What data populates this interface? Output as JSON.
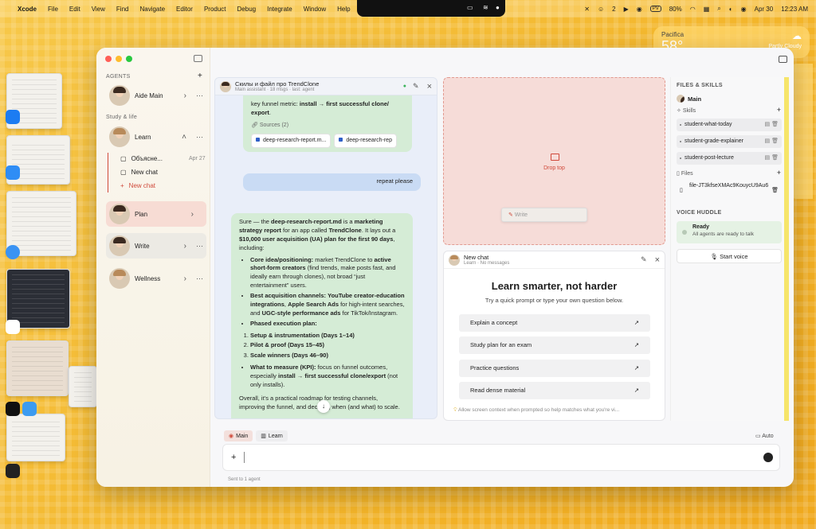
{
  "menubar": {
    "app": "Xcode",
    "items": [
      "File",
      "Edit",
      "View",
      "Find",
      "Navigate",
      "Editor",
      "Product",
      "Debug",
      "Integrate",
      "Window",
      "Help"
    ],
    "right": {
      "badge_count": "2",
      "pv": "PV",
      "battery": "80%",
      "date": "Apr 30",
      "time": "12:23 AM"
    }
  },
  "weather": {
    "city": "Pacifica",
    "temp": "58°",
    "cond": "Partly Cloudy"
  },
  "sidebar": {
    "agents_label": "AGENTS",
    "aide": "Aide Main",
    "study_label": "Study & life",
    "learn": "Learn",
    "sub_chat_1": "Объясне...",
    "sub_chat_1_date": "Apr 27",
    "sub_chat_2": "New chat",
    "sub_new": "New chat",
    "plan": "Plan",
    "write": "Write",
    "wellness": "Wellness"
  },
  "chat": {
    "title": "Скилы и файл про TrendClone",
    "subtitle": "Main assistant · 18 msgs · last: agent",
    "top_text_1": "key funnel metric: ",
    "top_text_bold": "install → first successful clone/ export",
    "sources_label": "Sources (2)",
    "source_1": "deep-research-report.m...",
    "source_2": "deep-research-rep",
    "user_msg": "repeat please",
    "reply_intro_1": "Sure — the ",
    "reply_file": "deep-research-report.md",
    "reply_intro_2": " is a ",
    "reply_bold_1": "marketing strategy report",
    "reply_intro_3": " for an app called ",
    "reply_app": "TrendClone",
    "reply_intro_4": ". It lays out a ",
    "reply_bold_2": "$10,000 user acquisition (UA) plan for the first 90 days",
    "reply_intro_5": ", including:",
    "b1_bold": "Core idea/positioning:",
    "b1_text_1": " market TrendClone to ",
    "b1_bold_2": "active short-form creators",
    "b1_text_2": " (find trends, make posts fast, and ideally earn through clones), not broad “just entertainment” users.",
    "b2_bold": "Best acquisition channels:",
    "b2_text_1": " ",
    "b2_bold_2": "YouTube creator-education integrations",
    "b2_text_2": ", ",
    "b2_bold_3": "Apple Search Ads",
    "b2_text_3": " for high-intent searches, and ",
    "b2_bold_4": "UGC-style performance ads",
    "b2_text_4": " for TikTok/Instagram.",
    "b3_bold": "Phased execution plan:",
    "p1": "Setup & instrumentation (Days 1–14)",
    "p2": "Pilot & proof (Days 15–45)",
    "p3": "Scale winners (Days 46–90)",
    "b4_bold": "What to measure (KPI):",
    "b4_text_1": " focus on funnel outcomes, especially ",
    "b4_bold_2": "install → first successful clone/export",
    "b4_text_2": " (not only installs).",
    "outro": "Overall, it’s a practical roadmap for testing channels, improving the funnel, and deciding when (and what) to scale."
  },
  "dropzone": {
    "label": "Drop top",
    "write": "Write"
  },
  "newchat": {
    "title": "New chat",
    "subtitle": "Learn · No messages",
    "hero": "Learn smarter, not harder",
    "sub": "Try a quick prompt or type your own question below.",
    "prompts": [
      "Explain a concept",
      "Study plan for an exam",
      "Practice questions",
      "Read dense material"
    ],
    "context": "Allow screen context when prompted so help matches what you're vi..."
  },
  "files": {
    "heading": "FILES & SKILLS",
    "main": "Main",
    "skills_label": "Skills",
    "skills": [
      "student-what-today",
      "student-grade-explainer",
      "student-post-lecture"
    ],
    "files_label": "Files",
    "file_1": "file-JT3kfseXMAc9KouycU9Au6",
    "voice_heading": "VOICE HUDDLE",
    "ready": "Ready",
    "ready_sub": "All agents are ready to talk",
    "start_voice": "Start voice"
  },
  "composer": {
    "tab_main": "Main",
    "tab_learn": "Learn",
    "auto": "Auto",
    "sent": "Sent to 1 agent"
  },
  "colors": {
    "accent_red": "#d0493a",
    "traffic_red": "#ff5f57",
    "traffic_yellow": "#febc2e",
    "traffic_green": "#28c840"
  }
}
